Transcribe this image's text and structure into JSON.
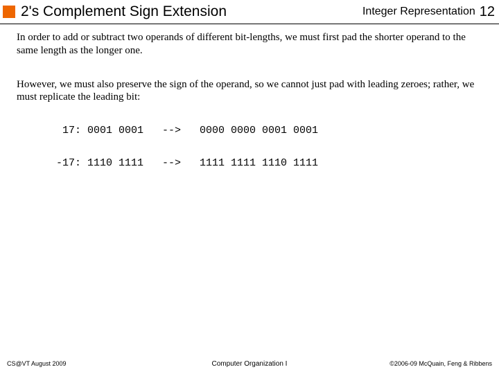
{
  "header": {
    "title": "2's Complement Sign Extension",
    "section": "Integer Representation",
    "page": "12"
  },
  "body": {
    "p1": "In order to add or subtract two operands of different bit-lengths, we must first pad the shorter operand to the same length as the longer one.",
    "p2": "However, we must also preserve the sign of the operand, so we cannot just pad with leading zeroes; rather, we must replicate the leading bit:",
    "ex1": "  17: 0001 0001   -->   0000 0000 0001 0001",
    "ex2": " -17: 1110 1111   -->   1111 1111 1110 1111"
  },
  "footer": {
    "left": "CS@VT August 2009",
    "center": "Computer Organization I",
    "right": "©2006-09 McQuain, Feng & Ribbens"
  }
}
